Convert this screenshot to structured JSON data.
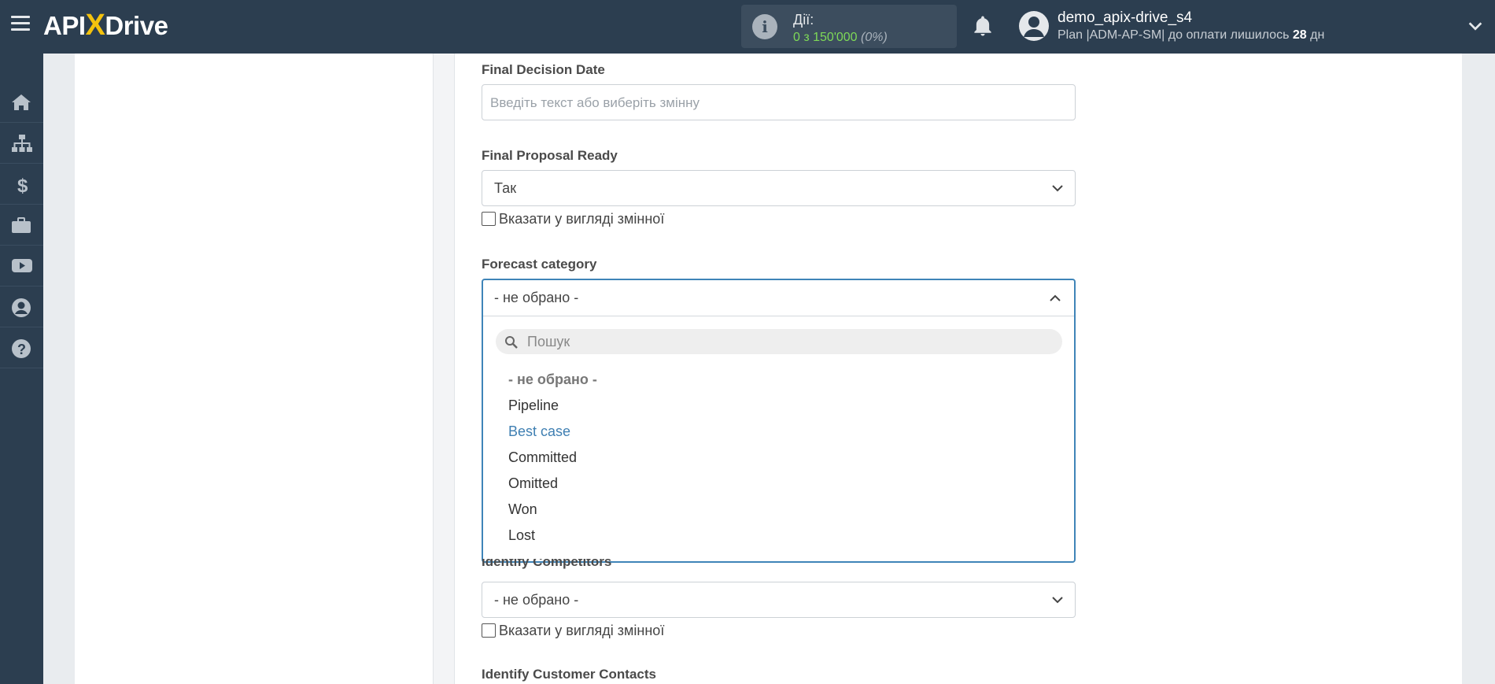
{
  "header": {
    "logo_left": "API",
    "logo_x": "X",
    "logo_right": "Drive",
    "actions_label": "Дії:",
    "actions_count": "0 з 150'000",
    "actions_percent": "(0%)",
    "user_name": "demo_apix-drive_s4",
    "plan_text": "Plan |ADM-AP-SM| до оплати лишилось",
    "plan_days": "28",
    "plan_days_unit": "дн"
  },
  "sidebar": {
    "items": [
      {
        "icon": "home-icon"
      },
      {
        "icon": "sitemap-icon"
      },
      {
        "icon": "dollar-icon"
      },
      {
        "icon": "briefcase-icon"
      },
      {
        "icon": "youtube-icon"
      },
      {
        "icon": "user-circle-icon"
      },
      {
        "icon": "question-icon"
      }
    ]
  },
  "form": {
    "final_decision_date": {
      "label": "Final Decision Date",
      "placeholder": "Введіть текст або виберіть змінну"
    },
    "final_proposal_ready": {
      "label": "Final Proposal Ready",
      "value": "Так",
      "checkbox_label": "Вказати у вигляді змінної"
    },
    "forecast_category": {
      "label": "Forecast category",
      "value": "- не обрано -",
      "search_placeholder": "Пошук",
      "options": [
        "- не обрано -",
        "Pipeline",
        "Best case",
        "Committed",
        "Omitted",
        "Won",
        "Lost"
      ],
      "highlighted": "Best case"
    },
    "identify_competitors": {
      "label": "Identify Competitors",
      "value": "- не обрано -",
      "checkbox_label": "Вказати у вигляді змінної"
    },
    "identify_customer_contacts": {
      "label": "Identify Customer Contacts"
    }
  },
  "colors": {
    "topbar": "#2c3e50",
    "accent": "#3f84b8",
    "logo_accent": "#f4c20d",
    "actions_count": "#7ed957"
  }
}
